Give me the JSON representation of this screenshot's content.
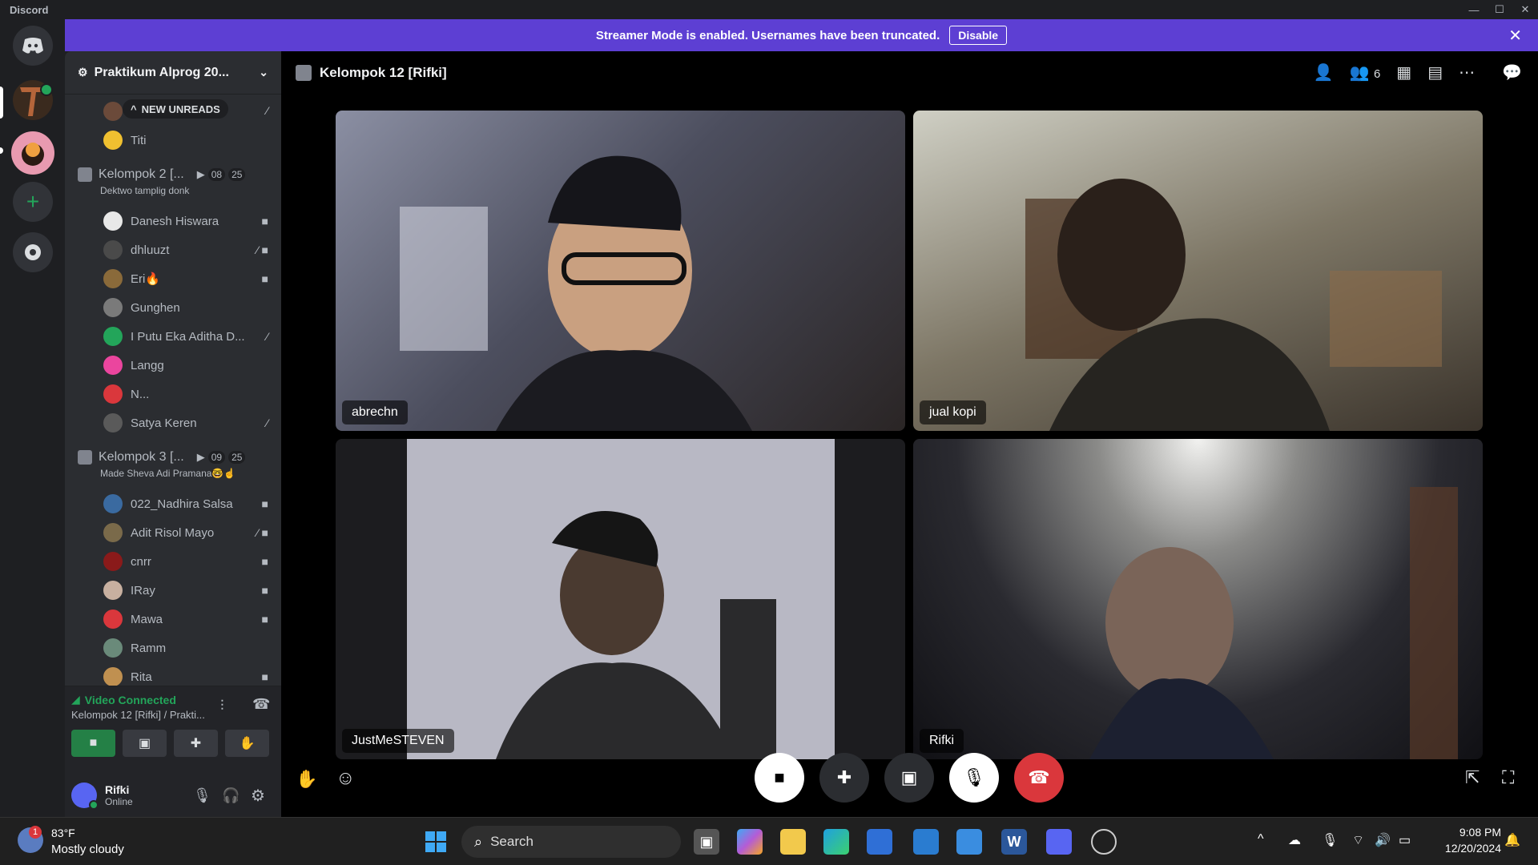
{
  "window": {
    "app_name": "Discord",
    "min": "—",
    "max": "☐",
    "close": "✕"
  },
  "banner": {
    "message": "Streamer Mode is enabled. Usernames have been truncated.",
    "disable_label": "Disable",
    "close": "✕"
  },
  "sidebar": {
    "guild_name": "Praktikum Alprog 20...",
    "new_unreads": "NEW UNREADS",
    "top_member": "Titi",
    "channel2": {
      "name": "Kelompok 2 [...",
      "video_count": "08",
      "user_count": "25",
      "status": "Dektwo tamplig donk",
      "members": [
        "Danesh Hiswara",
        "dhluuzt",
        "Eri🔥",
        "Gunghen",
        "I Putu Eka Aditha D...",
        "Langg",
        "N...",
        "Satya Keren"
      ]
    },
    "channel3": {
      "name": "Kelompok 3 [...",
      "video_count": "09",
      "user_count": "25",
      "status": "Made Sheva Adi Pramana🤓☝",
      "members": [
        "022_Nadhira Salsa",
        "Adit Risol Mayo",
        "cnrr",
        "IRay",
        "Mawa",
        "Ramm",
        "Rita"
      ]
    },
    "voice": {
      "status": "Video Connected",
      "channel": "Kelompok 12 [Rifki] / Prakti..."
    },
    "user": {
      "name": "Rifki",
      "status": "Online"
    }
  },
  "main": {
    "channel_title": "Kelompok 12 [Rifki]",
    "participant_count": "6",
    "tiles": [
      "abrechn",
      "jual kopi",
      "JustMeSTEVEN",
      "Rifki"
    ]
  },
  "taskbar": {
    "weather_temp": "83°F",
    "weather_desc": "Mostly cloudy",
    "weather_badge": "1",
    "search_label": "Search",
    "time": "9:08 PM",
    "date": "12/20/2024"
  },
  "colors": {
    "accent": "#5d3fd3",
    "green": "#248046",
    "red": "#da373c",
    "blurple": "#5865f2"
  }
}
